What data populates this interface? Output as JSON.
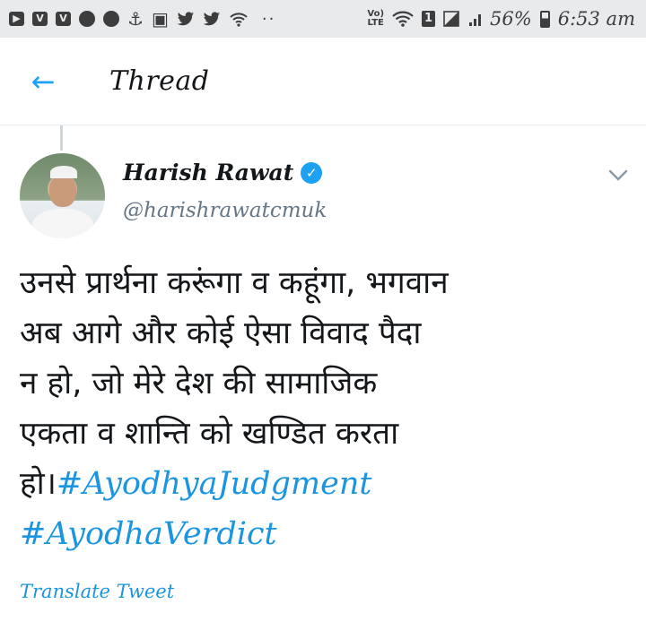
{
  "status_bar": {
    "left_icons": [
      {
        "name": "youtube-icon",
        "glyph": "▶"
      },
      {
        "name": "v-app-icon",
        "glyph": "V"
      },
      {
        "name": "v-app-icon-2",
        "glyph": "V"
      },
      {
        "name": "chat-bubble-icon",
        "glyph": ""
      },
      {
        "name": "chat-bubble-icon-2",
        "glyph": ""
      },
      {
        "name": "usb-icon",
        "glyph": "⚓"
      },
      {
        "name": "image-icon",
        "glyph": "▣"
      },
      {
        "name": "twitter-icon",
        "glyph": "🐦"
      },
      {
        "name": "twitter-icon-2",
        "glyph": "🐦"
      },
      {
        "name": "wifi-hotspot-icon",
        "glyph": "◠"
      }
    ],
    "more": "··",
    "volte": "Vo)\nLTE",
    "sim_slot": "1",
    "battery_percent": "56%",
    "time": "6:53 am"
  },
  "header": {
    "back_glyph": "←",
    "title": "Thread"
  },
  "tweet": {
    "author_name": "Harish Rawat",
    "verified_glyph": "✓",
    "handle": "@harishrawatcmuk",
    "menu_glyph": "⌄",
    "text_body": "उनसे प्रार्थना करूंगा व कहूंगा, भगवान\nअब आगे और कोई ऐसा विवाद पैदा\nन हो, जो मेरे देश की सामाजिक\nएकता व शान्ति को खण्डित करता\nहो।",
    "hashtags": [
      "#AyodhyaJudgment",
      "#AyodhaVerdict"
    ],
    "translate_label": "Translate Tweet"
  },
  "colors": {
    "accent": "#1da1f2",
    "link": "#1b95e0",
    "status_bar_bg": "#e9eaec",
    "muted": "#657786"
  }
}
